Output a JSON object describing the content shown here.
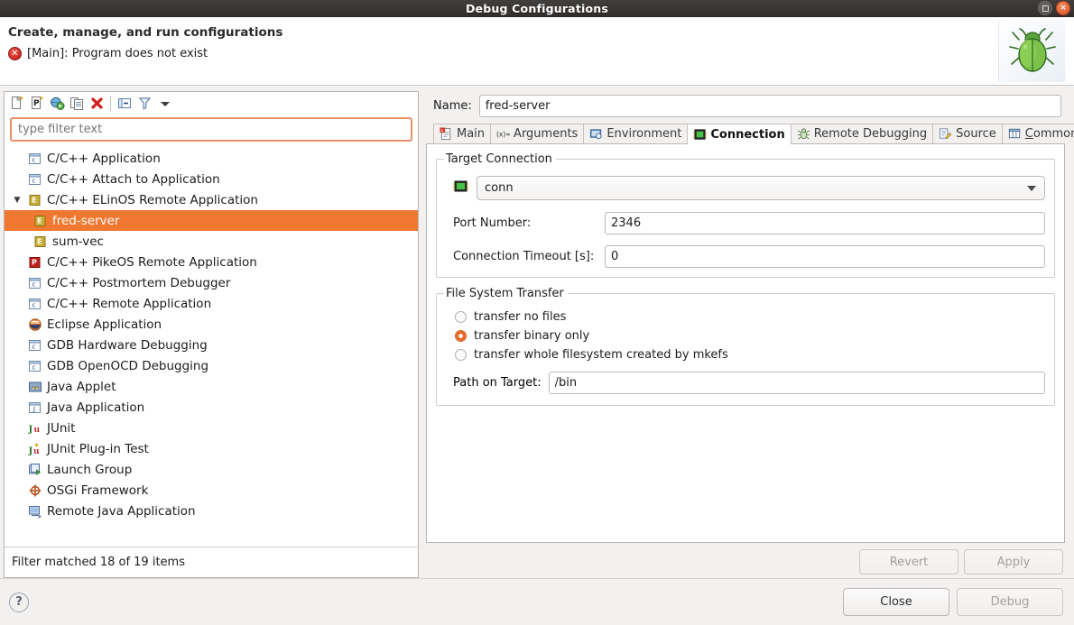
{
  "window": {
    "title": "Debug Configurations",
    "restore_label": "restore-window",
    "close_label": "×"
  },
  "header": {
    "title": "Create, manage, and run configurations",
    "error_text": "[Main]: Program does not exist",
    "error_icon": "error-icon",
    "banner_icon": "bug-icon"
  },
  "toolbar": {
    "buttons": [
      {
        "name": "new-launch-configuration",
        "icon": "new-config-icon"
      },
      {
        "name": "new-prototype",
        "icon": "new-prototype-icon"
      },
      {
        "name": "export-configuration",
        "icon": "export-icon"
      },
      {
        "name": "duplicate-configuration",
        "icon": "duplicate-icon"
      },
      {
        "name": "delete-configuration",
        "icon": "delete-icon"
      },
      {
        "name": "collapse-all",
        "icon": "collapse-all-icon"
      },
      {
        "name": "filter-configurations",
        "icon": "filter-icon"
      },
      {
        "name": "view-menu",
        "icon": "chevron-down-icon"
      }
    ]
  },
  "filter": {
    "value": "",
    "placeholder": "type filter text"
  },
  "tree": {
    "items": [
      {
        "label": "C/C++ Application",
        "icon": "c-app-icon",
        "level": 0,
        "twisty": "",
        "selected": false
      },
      {
        "label": "C/C++ Attach to Application",
        "icon": "c-app-icon",
        "level": 0,
        "twisty": "",
        "selected": false
      },
      {
        "label": "C/C++ ELinOS Remote Application",
        "icon": "elinos-icon",
        "level": 0,
        "twisty": "▼",
        "selected": false
      },
      {
        "label": "fred-server",
        "icon": "elinos-config-icon",
        "level": 1,
        "twisty": "",
        "selected": true
      },
      {
        "label": "sum-vec",
        "icon": "elinos-config-icon",
        "level": 1,
        "twisty": "",
        "selected": false
      },
      {
        "label": "C/C++ PikeOS Remote Application",
        "icon": "pikeos-icon",
        "level": 0,
        "twisty": "",
        "selected": false
      },
      {
        "label": "C/C++ Postmortem Debugger",
        "icon": "c-app-icon",
        "level": 0,
        "twisty": "",
        "selected": false
      },
      {
        "label": "C/C++ Remote Application",
        "icon": "c-app-icon",
        "level": 0,
        "twisty": "",
        "selected": false
      },
      {
        "label": "Eclipse Application",
        "icon": "eclipse-icon",
        "level": 0,
        "twisty": "",
        "selected": false
      },
      {
        "label": "GDB Hardware Debugging",
        "icon": "c-app-icon",
        "level": 0,
        "twisty": "",
        "selected": false
      },
      {
        "label": "GDB OpenOCD Debugging",
        "icon": "c-app-icon",
        "level": 0,
        "twisty": "",
        "selected": false
      },
      {
        "label": "Java Applet",
        "icon": "java-applet-icon",
        "level": 0,
        "twisty": "",
        "selected": false
      },
      {
        "label": "Java Application",
        "icon": "java-app-icon",
        "level": 0,
        "twisty": "",
        "selected": false
      },
      {
        "label": "JUnit",
        "icon": "junit-icon",
        "level": 0,
        "twisty": "",
        "selected": false
      },
      {
        "label": "JUnit Plug-in Test",
        "icon": "junit-plugin-icon",
        "level": 0,
        "twisty": "",
        "selected": false
      },
      {
        "label": "Launch Group",
        "icon": "launch-group-icon",
        "level": 0,
        "twisty": "",
        "selected": false
      },
      {
        "label": "OSGi Framework",
        "icon": "osgi-icon",
        "level": 0,
        "twisty": "",
        "selected": false
      },
      {
        "label": "Remote Java Application",
        "icon": "remote-java-icon",
        "level": 0,
        "twisty": "",
        "selected": false
      }
    ],
    "footer": "Filter matched 18 of 19 items"
  },
  "config": {
    "name_label": "Name:",
    "name_value": "fred-server",
    "tabs": [
      {
        "label": "Main",
        "icon": "main-tab-icon",
        "active": false
      },
      {
        "label": "Arguments",
        "icon": "arguments-tab-icon",
        "active": false
      },
      {
        "label": "Environment",
        "icon": "environment-tab-icon",
        "active": false
      },
      {
        "label": "Connection",
        "icon": "connection-tab-icon",
        "active": true
      },
      {
        "label": "Remote Debugging",
        "icon": "remote-debugging-tab-icon",
        "active": false
      },
      {
        "label": "Source",
        "icon": "source-tab-icon",
        "active": false
      },
      {
        "label": "Common",
        "icon": "common-tab-icon",
        "active": false,
        "mnemonic": "C"
      }
    ],
    "target_connection": {
      "legend": "Target Connection",
      "connection_icon": "connection-icon",
      "connection_value": "conn",
      "port_label": "Port Number:",
      "port_value": "2346",
      "timeout_label": "Connection Timeout [s]:",
      "timeout_value": "0"
    },
    "file_system_transfer": {
      "legend": "File System Transfer",
      "options": [
        {
          "label": "transfer no files",
          "checked": false
        },
        {
          "label": "transfer binary only",
          "checked": true
        },
        {
          "label": "transfer whole filesystem created by mkefs",
          "checked": false
        }
      ],
      "path_label": "Path on Target:",
      "path_value": "/bin"
    },
    "revert_label": "Revert",
    "apply_label": "Apply",
    "revert_enabled": false,
    "apply_enabled": false
  },
  "footer": {
    "help_label": "?",
    "close_label": "Close",
    "debug_label": "Debug",
    "close_enabled": true,
    "debug_enabled": false
  },
  "colors": {
    "selection": "#f07830",
    "radio_accent": "#e8651f",
    "error": "#c01b18",
    "titlebar": "#393735",
    "close_button": "#d8512a"
  }
}
